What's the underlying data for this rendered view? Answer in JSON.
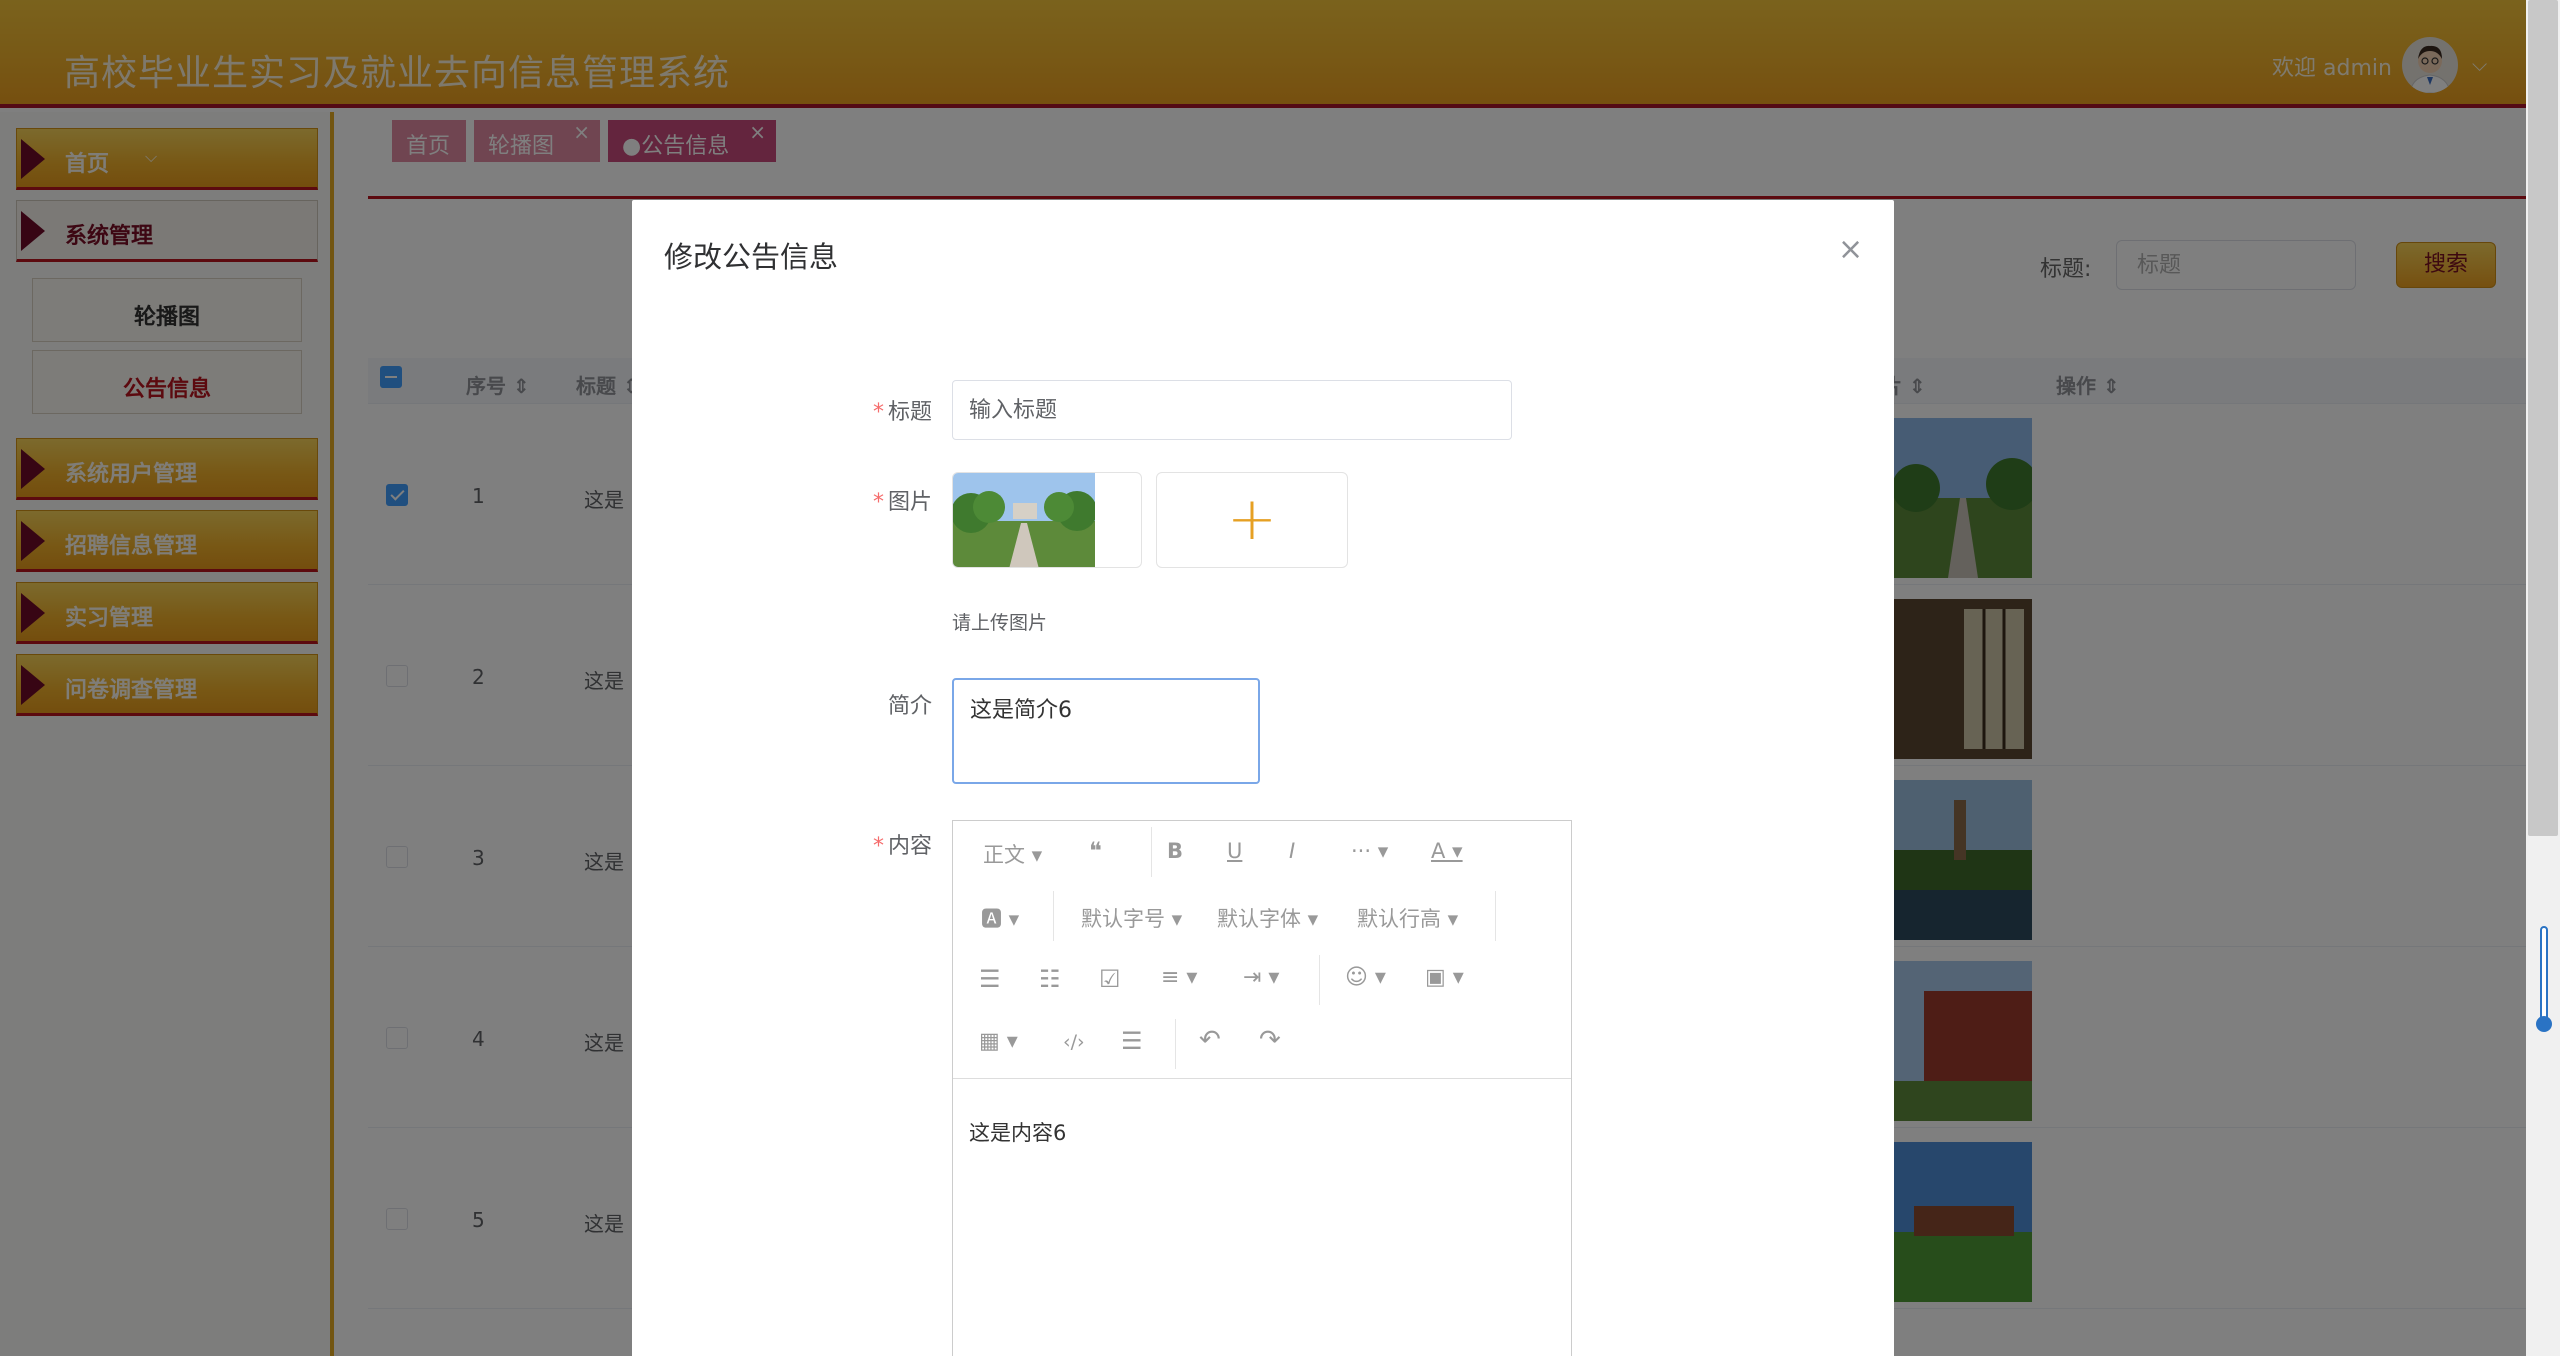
{
  "header": {
    "app_title": "高校毕业生实习及就业去向信息管理系统",
    "welcome": "欢迎 admin",
    "chevron": "⌵"
  },
  "sidebar": {
    "items": [
      {
        "label": "首页",
        "dd": "⌵"
      },
      {
        "label": "系统管理"
      },
      {
        "label": "系统用户管理"
      },
      {
        "label": "招聘信息管理"
      },
      {
        "label": "实习管理"
      },
      {
        "label": "问卷调查管理"
      }
    ],
    "sub_items": [
      {
        "label": "轮播图"
      },
      {
        "label": "公告信息"
      }
    ]
  },
  "tabs": [
    {
      "label": "首页"
    },
    {
      "label": "轮播图",
      "close": "×"
    },
    {
      "label": "●公告信息",
      "close": "×"
    }
  ],
  "search": {
    "label": "标题:",
    "placeholder": "标题",
    "button": "搜索"
  },
  "table": {
    "headers": [
      "序号",
      "标题",
      "片",
      "操作"
    ],
    "sort_glyph": "⇕",
    "rows": [
      {
        "num": "1",
        "title": "这是",
        "checked": true
      },
      {
        "num": "2",
        "title": "这是",
        "checked": false
      },
      {
        "num": "3",
        "title": "这是",
        "checked": false
      },
      {
        "num": "4",
        "title": "这是",
        "checked": false
      },
      {
        "num": "5",
        "title": "这是",
        "checked": false
      }
    ]
  },
  "dialog": {
    "title": "修改公告信息",
    "close": "×",
    "required_mark": "*",
    "fields": {
      "title_label": "标题",
      "title_placeholder": "输入标题",
      "image_label": "图片",
      "upload_plus": "+",
      "upload_hint": "请上传图片",
      "intro_label": "简介",
      "intro_value": "这是简介6",
      "content_label": "内容",
      "content_value": "这是内容6"
    },
    "toolbar": {
      "paragraph": "正文 ▾",
      "quote": "❝",
      "bold": "B",
      "underline": "U",
      "italic": "I",
      "more": "··· ▾",
      "font_color": "A ▾",
      "bg_color": "🅰 ▾",
      "font_size": "默认字号 ▾",
      "font_family": "默认字体 ▾",
      "line_height": "默认行高 ▾",
      "bullet_list": "☰",
      "numbered_list": "☷",
      "todo": "☑",
      "align": "≡ ▾",
      "indent": "⇥ ▾",
      "emoji": "☺ ▾",
      "image": "▣ ▾",
      "table": "▦ ▾",
      "code": "‹/›",
      "divider": "☰",
      "undo": "↶",
      "redo": "↷"
    }
  },
  "colors": {
    "header_gold": "#f0b22c",
    "accent_red": "#b8141e",
    "tab_pink": "#e08aa2",
    "upload_plus": "#e6a023",
    "primary_blue": "#409eff"
  }
}
